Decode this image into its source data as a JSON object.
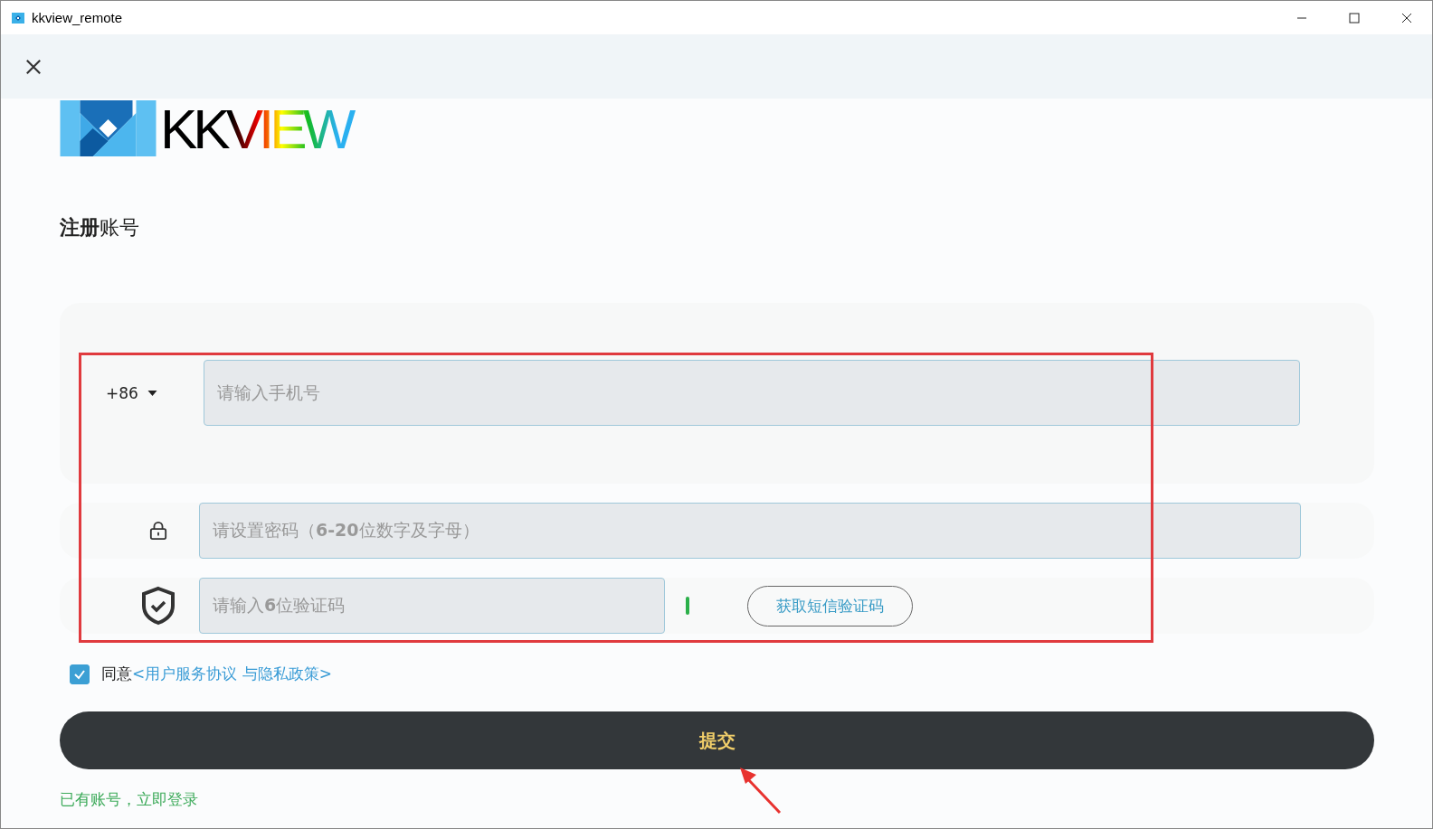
{
  "window": {
    "title": "kkview_remote"
  },
  "logo": {
    "wordmark": "KKVIEW"
  },
  "heading": "**注册**账号",
  "phone": {
    "country_code": "+86",
    "placeholder": "请输入手机号"
  },
  "password": {
    "placeholder": "请设置密码（**6-20**位数字及字母）"
  },
  "code": {
    "placeholder": "请输入**6**位验证码",
    "send_button": "获取短信验证码"
  },
  "agreement": {
    "checked": true,
    "label": "同意",
    "link": "<用户服务协议 与隐私政策>"
  },
  "submit": "提交",
  "login_link": "已有账号，立即登录"
}
